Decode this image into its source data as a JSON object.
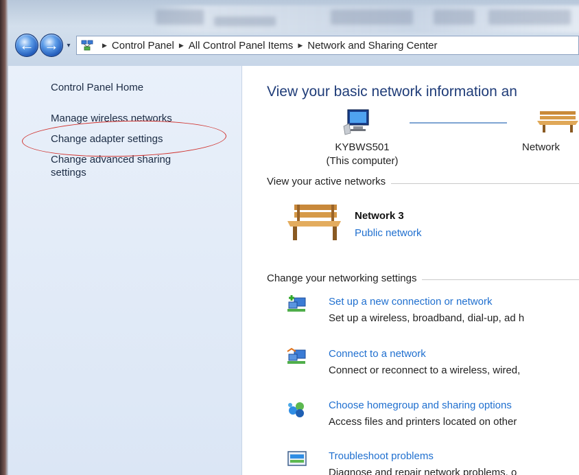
{
  "breadcrumb": {
    "items": [
      "Control Panel",
      "All Control Panel Items",
      "Network and Sharing Center"
    ]
  },
  "sidebar": {
    "home": "Control Panel Home",
    "links": [
      "Manage wireless networks",
      "Change adapter settings",
      "Change advanced sharing settings"
    ]
  },
  "main": {
    "title": "View your basic network information an",
    "computer_name": "KYBWS501",
    "computer_sub": "(This computer)",
    "map_network_label": "Network",
    "active_networks_heading": "View your active networks",
    "network_name": "Network  3",
    "network_type": "Public network",
    "change_settings_heading": "Change your networking settings",
    "tasks": [
      {
        "link": "Set up a new connection or network",
        "desc": "Set up a wireless, broadband, dial-up, ad h",
        "icon": "new-connection-icon"
      },
      {
        "link": "Connect to a network",
        "desc": "Connect or reconnect to a wireless, wired,",
        "icon": "connect-network-icon"
      },
      {
        "link": "Choose homegroup and sharing options",
        "desc": "Access files and printers located on other",
        "icon": "homegroup-icon"
      },
      {
        "link": "Troubleshoot problems",
        "desc": "Diagnose and repair network problems, o",
        "icon": "troubleshoot-icon"
      }
    ]
  },
  "colors": {
    "link": "#1f6fcf",
    "title": "#1f3c78",
    "highlight_circle": "#d0302c"
  }
}
